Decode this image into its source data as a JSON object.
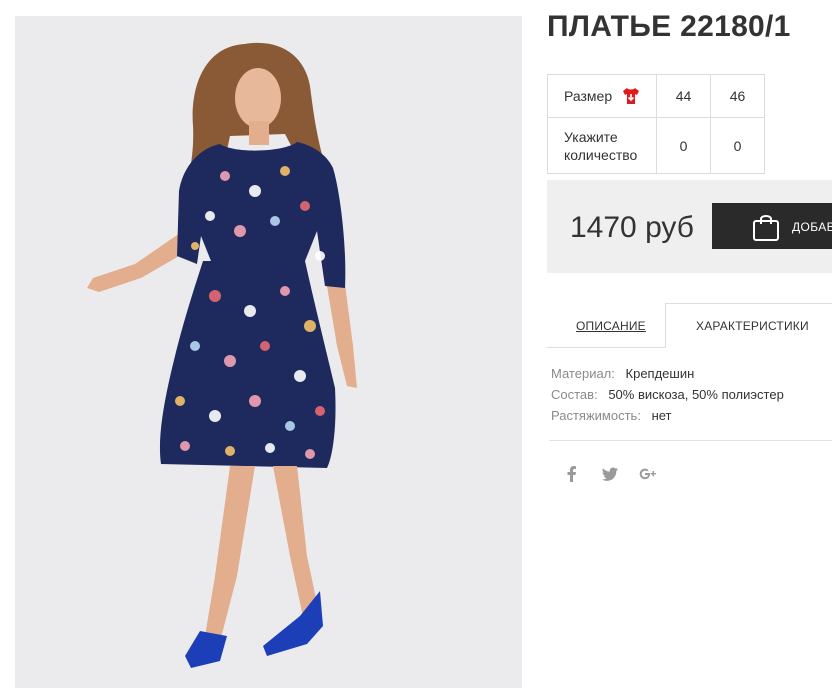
{
  "product": {
    "title": "ПЛАТЬЕ 22180/1",
    "image_alt": "Платье 22180/1"
  },
  "size_table": {
    "size_label": "Размер",
    "quantity_label": "Укажите количество",
    "sizes": [
      "44",
      "46"
    ],
    "quantities": [
      "0",
      "0"
    ],
    "size_icon": "shirt-icon"
  },
  "purchase": {
    "price": "1470 руб",
    "add_button_label": "ДОБАВИТЬ В КОРЗИНУ",
    "add_button_icon": "shopping-bag-icon"
  },
  "tabs": [
    {
      "label": "ОПИСАНИЕ",
      "active": false
    },
    {
      "label": "ХАРАКТЕРИСТИКИ",
      "active": true
    }
  ],
  "characteristics": [
    {
      "key": "Материал:",
      "value": "Крепдешин"
    },
    {
      "key": "Состав:",
      "value": "50% вискоза, 50% полиэстер"
    },
    {
      "key": "Растяжимость:",
      "value": "нет"
    }
  ],
  "social": [
    {
      "icon": "facebook-icon"
    },
    {
      "icon": "twitter-icon"
    },
    {
      "icon": "google-plus-icon"
    }
  ],
  "colors": {
    "button_bg": "#2a2a2a",
    "price_box_bg": "#efefef",
    "size_icon_red": "#e01b1b",
    "photo_bg": "#ebebed"
  }
}
